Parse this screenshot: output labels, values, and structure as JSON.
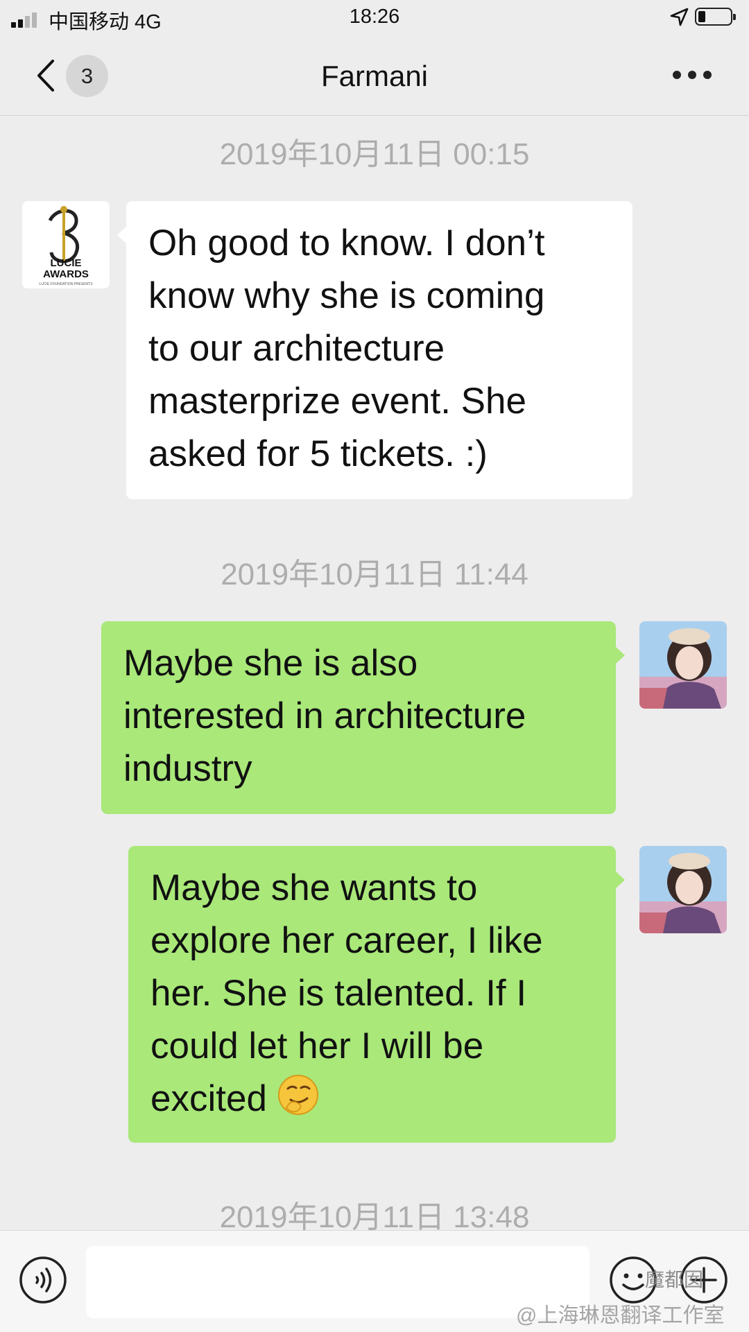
{
  "status_bar": {
    "carrier": "中国移动 4G",
    "time": "18:26",
    "icons": [
      "signal-icon",
      "location-icon",
      "battery-icon"
    ]
  },
  "nav": {
    "back_icon": "chevron-left-icon",
    "unread_count": "3",
    "title": "Farmani",
    "more_icon": "more-dots-icon"
  },
  "messages": [
    {
      "type": "timestamp",
      "text": "2019年10月11日 00:15"
    },
    {
      "type": "incoming",
      "avatar": "lucie-awards-logo",
      "lines": [
        "Oh good to know. I don’t",
        "know why she is coming",
        "to our architecture",
        "masterprize event. She",
        "asked for 5 tickets. :)"
      ]
    },
    {
      "type": "timestamp",
      "text": "2019年10月11日 11:44"
    },
    {
      "type": "outgoing",
      "avatar": "user-photo",
      "lines": [
        "Maybe she is also",
        "interested in architecture",
        "industry"
      ]
    },
    {
      "type": "outgoing",
      "avatar": "user-photo",
      "lines": [
        "Maybe she wants to",
        "explore her career, I like",
        "her. She is talented. If I",
        "could let her I will be",
        "excited"
      ],
      "emoji": "smirk-emoji-icon"
    },
    {
      "type": "timestamp",
      "text": "2019年10月11日 13:48"
    }
  ],
  "logo": {
    "lines": [
      "3",
      "LUCIE",
      "AWARDS",
      "LUCIE FOUNDATION PRESENTS"
    ]
  },
  "input_bar": {
    "icons": [
      "voice-icon",
      "emoji-icon",
      "plus-icon"
    ],
    "placeholder": ""
  },
  "watermark": {
    "tag": "魔都囡",
    "handle": "@上海琳恩翻译工作室"
  },
  "colors": {
    "background": "#ededed",
    "outgoing_bubble": "#a9e879",
    "incoming_bubble": "#ffffff",
    "timestamp": "#adadad"
  }
}
